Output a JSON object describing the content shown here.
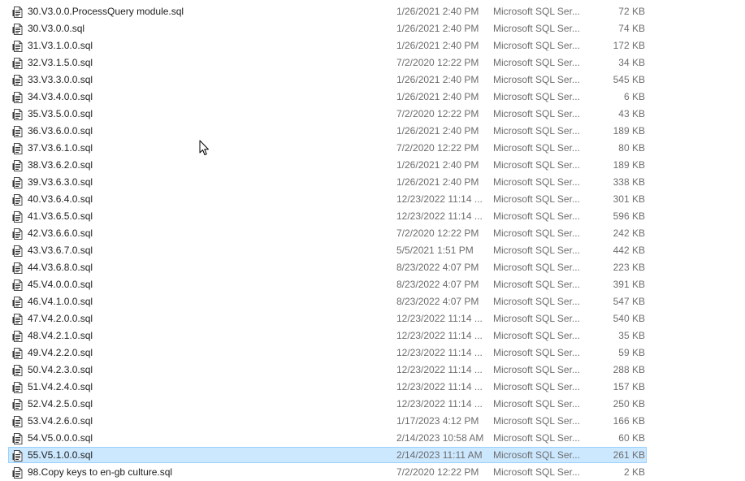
{
  "file_icon": "sql-script-file-icon",
  "cursor_icon": "mouse-pointer-icon",
  "files": [
    {
      "name": "30.V3.0.0.ProcessQuery module.sql",
      "date": "1/26/2021 2:40 PM",
      "type": "Microsoft SQL Ser...",
      "size": "72 KB"
    },
    {
      "name": "30.V3.0.0.sql",
      "date": "1/26/2021 2:40 PM",
      "type": "Microsoft SQL Ser...",
      "size": "74 KB"
    },
    {
      "name": "31.V3.1.0.0.sql",
      "date": "1/26/2021 2:40 PM",
      "type": "Microsoft SQL Ser...",
      "size": "172 KB"
    },
    {
      "name": "32.V3.1.5.0.sql",
      "date": "7/2/2020 12:22 PM",
      "type": "Microsoft SQL Ser...",
      "size": "34 KB"
    },
    {
      "name": "33.V3.3.0.0.sql",
      "date": "1/26/2021 2:40 PM",
      "type": "Microsoft SQL Ser...",
      "size": "545 KB"
    },
    {
      "name": "34.V3.4.0.0.sql",
      "date": "1/26/2021 2:40 PM",
      "type": "Microsoft SQL Ser...",
      "size": "6 KB"
    },
    {
      "name": "35.V3.5.0.0.sql",
      "date": "7/2/2020 12:22 PM",
      "type": "Microsoft SQL Ser...",
      "size": "43 KB"
    },
    {
      "name": "36.V3.6.0.0.sql",
      "date": "1/26/2021 2:40 PM",
      "type": "Microsoft SQL Ser...",
      "size": "189 KB"
    },
    {
      "name": "37.V3.6.1.0.sql",
      "date": "7/2/2020 12:22 PM",
      "type": "Microsoft SQL Ser...",
      "size": "80 KB"
    },
    {
      "name": "38.V3.6.2.0.sql",
      "date": "1/26/2021 2:40 PM",
      "type": "Microsoft SQL Ser...",
      "size": "189 KB"
    },
    {
      "name": "39.V3.6.3.0.sql",
      "date": "1/26/2021 2:40 PM",
      "type": "Microsoft SQL Ser...",
      "size": "338 KB"
    },
    {
      "name": "40.V3.6.4.0.sql",
      "date": "12/23/2022 11:14 ...",
      "type": "Microsoft SQL Ser...",
      "size": "301 KB"
    },
    {
      "name": "41.V3.6.5.0.sql",
      "date": "12/23/2022 11:14 ...",
      "type": "Microsoft SQL Ser...",
      "size": "596 KB"
    },
    {
      "name": "42.V3.6.6.0.sql",
      "date": "7/2/2020 12:22 PM",
      "type": "Microsoft SQL Ser...",
      "size": "242 KB"
    },
    {
      "name": "43.V3.6.7.0.sql",
      "date": "5/5/2021 1:51 PM",
      "type": "Microsoft SQL Ser...",
      "size": "442 KB"
    },
    {
      "name": "44.V3.6.8.0.sql",
      "date": "8/23/2022 4:07 PM",
      "type": "Microsoft SQL Ser...",
      "size": "223 KB"
    },
    {
      "name": "45.V4.0.0.0.sql",
      "date": "8/23/2022 4:07 PM",
      "type": "Microsoft SQL Ser...",
      "size": "391 KB"
    },
    {
      "name": "46.V4.1.0.0.sql",
      "date": "8/23/2022 4:07 PM",
      "type": "Microsoft SQL Ser...",
      "size": "547 KB"
    },
    {
      "name": "47.V4.2.0.0.sql",
      "date": "12/23/2022 11:14 ...",
      "type": "Microsoft SQL Ser...",
      "size": "540 KB"
    },
    {
      "name": "48.V4.2.1.0.sql",
      "date": "12/23/2022 11:14 ...",
      "type": "Microsoft SQL Ser...",
      "size": "35 KB"
    },
    {
      "name": "49.V4.2.2.0.sql",
      "date": "12/23/2022 11:14 ...",
      "type": "Microsoft SQL Ser...",
      "size": "59 KB"
    },
    {
      "name": "50.V4.2.3.0.sql",
      "date": "12/23/2022 11:14 ...",
      "type": "Microsoft SQL Ser...",
      "size": "288 KB"
    },
    {
      "name": "51.V4.2.4.0.sql",
      "date": "12/23/2022 11:14 ...",
      "type": "Microsoft SQL Ser...",
      "size": "157 KB"
    },
    {
      "name": "52.V4.2.5.0.sql",
      "date": "12/23/2022 11:14 ...",
      "type": "Microsoft SQL Ser...",
      "size": "250 KB"
    },
    {
      "name": "53.V4.2.6.0.sql",
      "date": "1/17/2023 4:12 PM",
      "type": "Microsoft SQL Ser...",
      "size": "166 KB"
    },
    {
      "name": "54.V5.0.0.0.sql",
      "date": "2/14/2023 10:58 AM",
      "type": "Microsoft SQL Ser...",
      "size": "60 KB"
    },
    {
      "name": "55.V5.1.0.0.sql",
      "date": "2/14/2023 11:11 AM",
      "type": "Microsoft SQL Ser...",
      "size": "261 KB",
      "selected": true
    },
    {
      "name": "98.Copy keys to en-gb culture.sql",
      "date": "7/2/2020 12:22 PM",
      "type": "Microsoft SQL Ser...",
      "size": "2 KB"
    }
  ],
  "colors": {
    "selection_fill": "#cce8ff",
    "selection_border": "#99d1ff",
    "secondary_text": "#6d6d6d"
  }
}
